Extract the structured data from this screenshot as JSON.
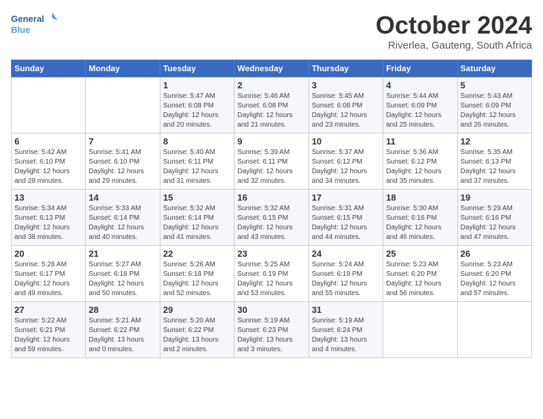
{
  "header": {
    "logo_line1": "General",
    "logo_line2": "Blue",
    "month": "October 2024",
    "location": "Riverlea, Gauteng, South Africa"
  },
  "days_of_week": [
    "Sunday",
    "Monday",
    "Tuesday",
    "Wednesday",
    "Thursday",
    "Friday",
    "Saturday"
  ],
  "weeks": [
    [
      {
        "day": "",
        "info": ""
      },
      {
        "day": "",
        "info": ""
      },
      {
        "day": "1",
        "info": "Sunrise: 5:47 AM\nSunset: 6:08 PM\nDaylight: 12 hours\nand 20 minutes."
      },
      {
        "day": "2",
        "info": "Sunrise: 5:46 AM\nSunset: 6:08 PM\nDaylight: 12 hours\nand 21 minutes."
      },
      {
        "day": "3",
        "info": "Sunrise: 5:45 AM\nSunset: 6:08 PM\nDaylight: 12 hours\nand 23 minutes."
      },
      {
        "day": "4",
        "info": "Sunrise: 5:44 AM\nSunset: 6:09 PM\nDaylight: 12 hours\nand 25 minutes."
      },
      {
        "day": "5",
        "info": "Sunrise: 5:43 AM\nSunset: 6:09 PM\nDaylight: 12 hours\nand 26 minutes."
      }
    ],
    [
      {
        "day": "6",
        "info": "Sunrise: 5:42 AM\nSunset: 6:10 PM\nDaylight: 12 hours\nand 28 minutes."
      },
      {
        "day": "7",
        "info": "Sunrise: 5:41 AM\nSunset: 6:10 PM\nDaylight: 12 hours\nand 29 minutes."
      },
      {
        "day": "8",
        "info": "Sunrise: 5:40 AM\nSunset: 6:11 PM\nDaylight: 12 hours\nand 31 minutes."
      },
      {
        "day": "9",
        "info": "Sunrise: 5:39 AM\nSunset: 6:11 PM\nDaylight: 12 hours\nand 32 minutes."
      },
      {
        "day": "10",
        "info": "Sunrise: 5:37 AM\nSunset: 6:12 PM\nDaylight: 12 hours\nand 34 minutes."
      },
      {
        "day": "11",
        "info": "Sunrise: 5:36 AM\nSunset: 6:12 PM\nDaylight: 12 hours\nand 35 minutes."
      },
      {
        "day": "12",
        "info": "Sunrise: 5:35 AM\nSunset: 6:13 PM\nDaylight: 12 hours\nand 37 minutes."
      }
    ],
    [
      {
        "day": "13",
        "info": "Sunrise: 5:34 AM\nSunset: 6:13 PM\nDaylight: 12 hours\nand 38 minutes."
      },
      {
        "day": "14",
        "info": "Sunrise: 5:33 AM\nSunset: 6:14 PM\nDaylight: 12 hours\nand 40 minutes."
      },
      {
        "day": "15",
        "info": "Sunrise: 5:32 AM\nSunset: 6:14 PM\nDaylight: 12 hours\nand 41 minutes."
      },
      {
        "day": "16",
        "info": "Sunrise: 5:32 AM\nSunset: 6:15 PM\nDaylight: 12 hours\nand 43 minutes."
      },
      {
        "day": "17",
        "info": "Sunrise: 5:31 AM\nSunset: 6:15 PM\nDaylight: 12 hours\nand 44 minutes."
      },
      {
        "day": "18",
        "info": "Sunrise: 5:30 AM\nSunset: 6:16 PM\nDaylight: 12 hours\nand 46 minutes."
      },
      {
        "day": "19",
        "info": "Sunrise: 5:29 AM\nSunset: 6:16 PM\nDaylight: 12 hours\nand 47 minutes."
      }
    ],
    [
      {
        "day": "20",
        "info": "Sunrise: 5:28 AM\nSunset: 6:17 PM\nDaylight: 12 hours\nand 49 minutes."
      },
      {
        "day": "21",
        "info": "Sunrise: 5:27 AM\nSunset: 6:18 PM\nDaylight: 12 hours\nand 50 minutes."
      },
      {
        "day": "22",
        "info": "Sunrise: 5:26 AM\nSunset: 6:18 PM\nDaylight: 12 hours\nand 52 minutes."
      },
      {
        "day": "23",
        "info": "Sunrise: 5:25 AM\nSunset: 6:19 PM\nDaylight: 12 hours\nand 53 minutes."
      },
      {
        "day": "24",
        "info": "Sunrise: 5:24 AM\nSunset: 6:19 PM\nDaylight: 12 hours\nand 55 minutes."
      },
      {
        "day": "25",
        "info": "Sunrise: 5:23 AM\nSunset: 6:20 PM\nDaylight: 12 hours\nand 56 minutes."
      },
      {
        "day": "26",
        "info": "Sunrise: 5:23 AM\nSunset: 6:20 PM\nDaylight: 12 hours\nand 57 minutes."
      }
    ],
    [
      {
        "day": "27",
        "info": "Sunrise: 5:22 AM\nSunset: 6:21 PM\nDaylight: 12 hours\nand 59 minutes."
      },
      {
        "day": "28",
        "info": "Sunrise: 5:21 AM\nSunset: 6:22 PM\nDaylight: 13 hours\nand 0 minutes."
      },
      {
        "day": "29",
        "info": "Sunrise: 5:20 AM\nSunset: 6:22 PM\nDaylight: 13 hours\nand 2 minutes."
      },
      {
        "day": "30",
        "info": "Sunrise: 5:19 AM\nSunset: 6:23 PM\nDaylight: 13 hours\nand 3 minutes."
      },
      {
        "day": "31",
        "info": "Sunrise: 5:19 AM\nSunset: 6:24 PM\nDaylight: 13 hours\nand 4 minutes."
      },
      {
        "day": "",
        "info": ""
      },
      {
        "day": "",
        "info": ""
      }
    ]
  ]
}
